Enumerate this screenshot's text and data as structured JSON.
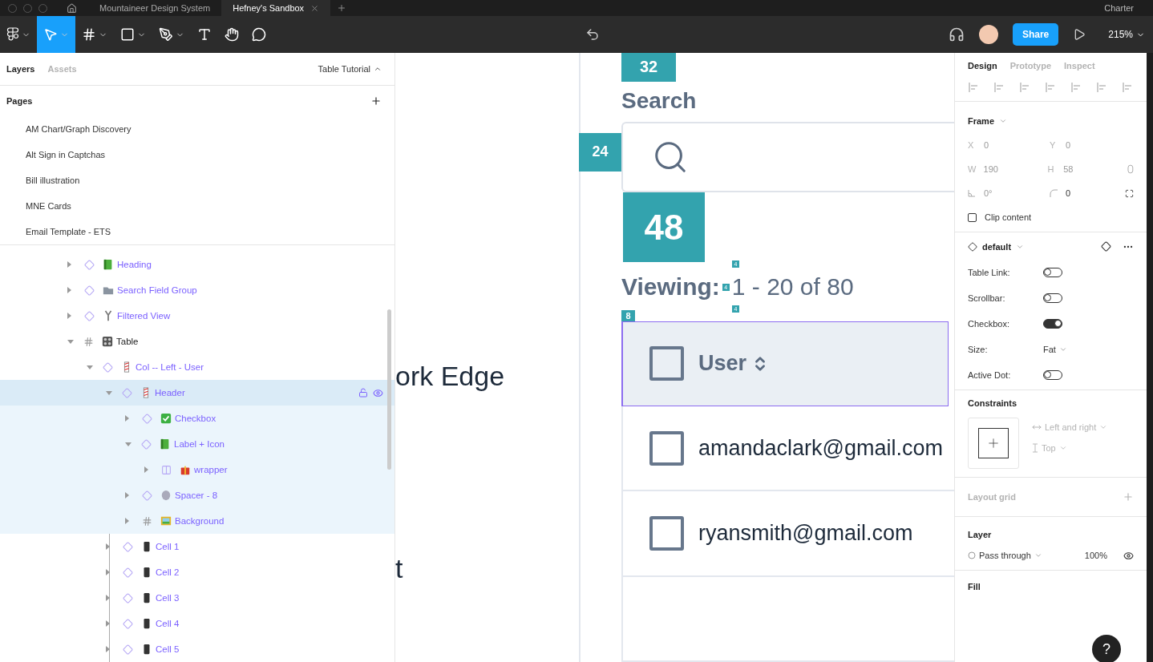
{
  "browser_tabs": [
    {
      "label": "Mountaineer Design System",
      "selected": false
    },
    {
      "label": "Hefney's Sandbox",
      "selected": true
    }
  ],
  "browser_right_tab": "Charter",
  "toolbar": {
    "tools": [
      {
        "kind": "menu",
        "selected": false
      },
      {
        "kind": "move",
        "selected": true
      },
      {
        "kind": "frame",
        "selected": false
      },
      {
        "kind": "shape",
        "selected": false
      },
      {
        "kind": "pen",
        "selected": false
      },
      {
        "kind": "text",
        "selected": false
      },
      {
        "kind": "hand",
        "selected": false
      },
      {
        "kind": "comment",
        "selected": false
      }
    ],
    "share": "Share",
    "zoom": "215%"
  },
  "left_panel": {
    "tabs": [
      {
        "label": "Layers",
        "selected": true
      },
      {
        "label": "Assets",
        "selected": false
      }
    ],
    "page_name": "Table Tutorial",
    "pages_title": "Pages",
    "pages": [
      "AM Chart/Graph Discovery",
      "Alt Sign in Captchas",
      "Bill illustration",
      "MNE Cards",
      "Email Template - ETS"
    ],
    "layers": [
      {
        "name": "Heading",
        "kind": "instance",
        "expanded": false,
        "selected": false
      },
      {
        "name": "Search Field Group",
        "kind": "instance",
        "expanded": false,
        "selected": false
      },
      {
        "name": "Filtered View",
        "kind": "instance",
        "expanded": false,
        "selected": false
      },
      {
        "name": "Table",
        "kind": "frame",
        "expanded": true,
        "selected": false,
        "children": [
          {
            "name": "Col -- Left - User",
            "kind": "instance",
            "expanded": true,
            "selected": false,
            "children": [
              {
                "name": "Header",
                "kind": "instance",
                "expanded": true,
                "selected": true,
                "children": [
                  {
                    "name": "Checkbox",
                    "kind": "instance",
                    "expanded": false,
                    "selected": false
                  },
                  {
                    "name": "Label + Icon",
                    "kind": "instance",
                    "expanded": true,
                    "selected": false,
                    "children": [
                      {
                        "name": "wrapper",
                        "kind": "autolayout",
                        "expanded": false,
                        "selected": false
                      }
                    ]
                  },
                  {
                    "name": "Spacer - 8",
                    "kind": "instance",
                    "expanded": false,
                    "selected": false
                  },
                  {
                    "name": "Background",
                    "kind": "frame",
                    "expanded": false,
                    "selected": false
                  }
                ]
              },
              {
                "name": "Cell 1",
                "kind": "instance",
                "expanded": false,
                "selected": false
              },
              {
                "name": "Cell 2",
                "kind": "instance",
                "expanded": false,
                "selected": false
              },
              {
                "name": "Cell 3",
                "kind": "instance",
                "expanded": false,
                "selected": false
              },
              {
                "name": "Cell 4",
                "kind": "instance",
                "expanded": false,
                "selected": false
              },
              {
                "name": "Cell 5",
                "kind": "instance",
                "expanded": false,
                "selected": false
              }
            ]
          }
        ]
      }
    ]
  },
  "canvas": {
    "texts": [
      "ork Edge",
      "t"
    ],
    "frame": {
      "top_spacing": "32",
      "search_label": "Search",
      "search_spacing": "24",
      "gap_spacing": "48",
      "viewing_label": "Viewing:",
      "viewing_value": "1 - 20 of 80",
      "small_spacings": [
        "4",
        "4",
        "4"
      ],
      "row_spacing": "8",
      "header": {
        "label": "User",
        "checked": false,
        "selected": true
      },
      "rows": [
        {
          "text": "amandaclark@gmail.com",
          "checked": false
        },
        {
          "text": "ryansmith@gmail.com",
          "checked": false
        }
      ]
    }
  },
  "right_panel": {
    "tabs": [
      {
        "label": "Design",
        "selected": true
      },
      {
        "label": "Prototype",
        "selected": false
      },
      {
        "label": "Inspect",
        "selected": false
      }
    ],
    "frame_title": "Frame",
    "fields": [
      {
        "label": "X",
        "value": "0",
        "disabled": true
      },
      {
        "label": "Y",
        "value": "0",
        "disabled": true
      },
      {
        "label": "W",
        "value": "190",
        "disabled": true
      },
      {
        "label": "H",
        "value": "58",
        "disabled": true
      }
    ],
    "rotation": "0°",
    "radius": "0",
    "clip_content": {
      "label": "Clip content",
      "checked": false
    },
    "component": "default",
    "properties": [
      {
        "label": "Table Link:",
        "kind": "toggle",
        "on": false
      },
      {
        "label": "Scrollbar:",
        "kind": "toggle",
        "on": false
      },
      {
        "label": "Checkbox:",
        "kind": "toggle",
        "on": true
      },
      {
        "label": "Size:",
        "kind": "dropdown",
        "value": "Fat"
      },
      {
        "label": "Active Dot:",
        "kind": "toggle",
        "on": false
      }
    ],
    "constraints_title": "Constraints",
    "horizontal": "Left and right",
    "vertical": "Top",
    "layout_grid": "Layout grid",
    "layer_title": "Layer",
    "blend": "Pass through",
    "opacity": "100%",
    "fill_title": "Fill"
  },
  "help": "?"
}
